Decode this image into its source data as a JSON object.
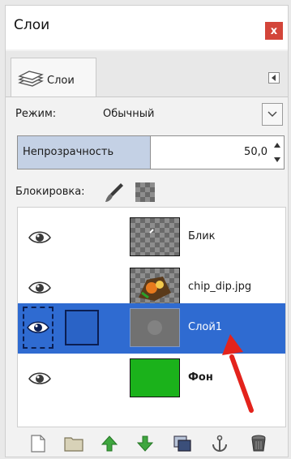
{
  "window": {
    "title": "Слои"
  },
  "close": {
    "label": "x"
  },
  "tab": {
    "label": "Слои",
    "icon": "layers-icon"
  },
  "mode": {
    "label": "Режим:",
    "value": "Обычный"
  },
  "opacity": {
    "label": "Непрозрачность",
    "value": "50,0",
    "fraction": 0.5
  },
  "lock": {
    "label": "Блокировка:"
  },
  "layers": [
    {
      "name": "Блик",
      "thumb": "transparent",
      "visible": true,
      "selected": false,
      "bold": false
    },
    {
      "name": "chip_dip.jpg",
      "thumb": "image",
      "visible": true,
      "selected": false,
      "bold": false
    },
    {
      "name": "Слой1",
      "thumb": "gray",
      "visible": true,
      "selected": true,
      "bold": false
    },
    {
      "name": "Фон",
      "thumb": "green",
      "visible": true,
      "selected": false,
      "bold": true
    }
  ],
  "colors": {
    "selection": "#2f6bd1",
    "close": "#d3453a",
    "green_layer": "#1bb21b",
    "arrow": "#e3231c"
  },
  "bottom_icons": [
    "new-layer-icon",
    "new-group-icon",
    "raise-layer-icon",
    "lower-layer-icon",
    "duplicate-layer-icon",
    "anchor-layer-icon",
    "delete-layer-icon"
  ]
}
